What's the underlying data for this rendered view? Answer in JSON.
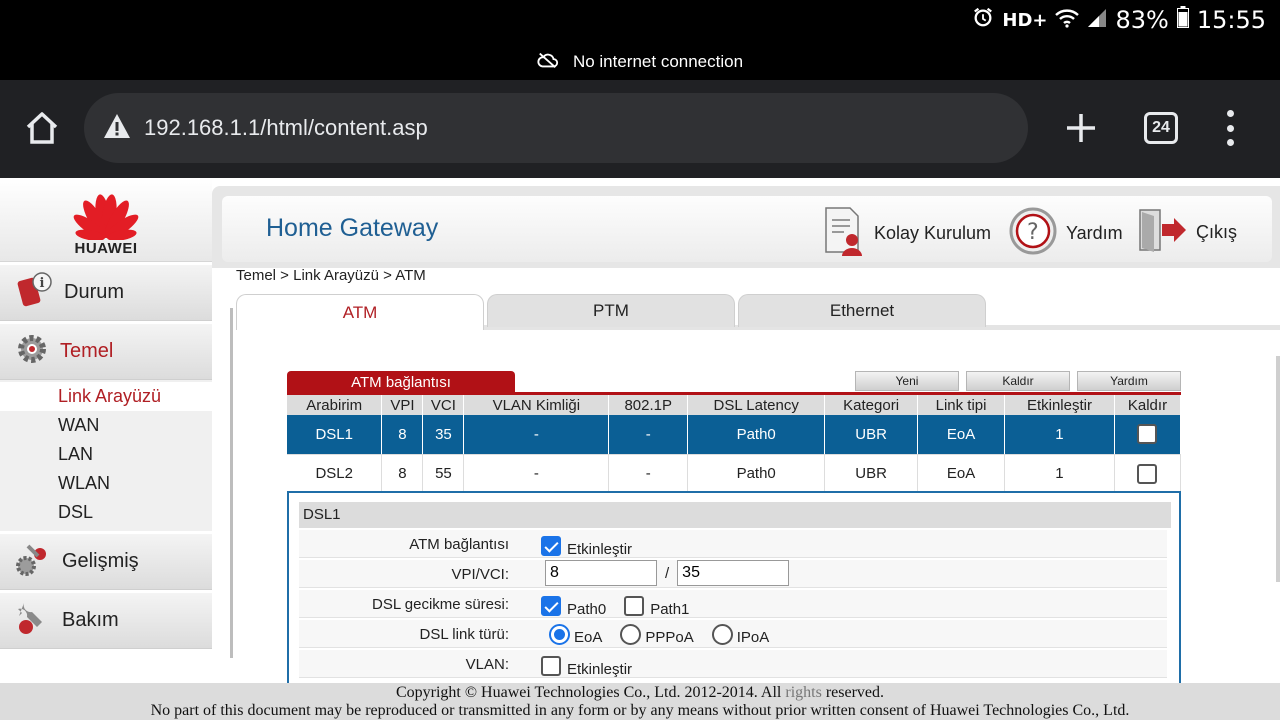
{
  "status_bar": {
    "alarm_icon": "alarm-icon",
    "network_type": "HD+",
    "battery_percent": "83%",
    "time": "15:55"
  },
  "connection_banner": {
    "text": "No internet connection"
  },
  "browser": {
    "url": "192.168.1.1/html/content.asp",
    "tab_count": "24"
  },
  "sidebar": {
    "logo_text": "HUAWEI",
    "items": [
      {
        "label": "Durum"
      },
      {
        "label": "Temel"
      },
      {
        "label": "Gelişmiş"
      },
      {
        "label": "Bakım"
      }
    ],
    "sub_items": [
      "Link Arayüzü",
      "WAN",
      "LAN",
      "WLAN",
      "DSL"
    ]
  },
  "header": {
    "title": "Home Gateway",
    "quick_setup": "Kolay Kurulum",
    "help": "Yardım",
    "exit": "Çıkış"
  },
  "breadcrumb": "Temel > Link Arayüzü > ATM",
  "tabs": [
    "ATM",
    "PTM",
    "Ethernet"
  ],
  "atm_table": {
    "title": "ATM bağlantısı",
    "buttons": {
      "new": "Yeni",
      "remove": "Kaldır",
      "help": "Yardım"
    },
    "columns": [
      "Arabirim",
      "VPI",
      "VCI",
      "VLAN Kimliği",
      "802.1P",
      "DSL Latency",
      "Kategori",
      "Link tipi",
      "Etkinleştir",
      "Kaldır"
    ],
    "rows": [
      {
        "cells": [
          "DSL1",
          "8",
          "35",
          "-",
          "-",
          "Path0",
          "UBR",
          "EoA",
          "1"
        ],
        "selected": true
      },
      {
        "cells": [
          "DSL2",
          "8",
          "55",
          "-",
          "-",
          "Path0",
          "UBR",
          "EoA",
          "1"
        ],
        "selected": false
      }
    ]
  },
  "detail": {
    "title": "DSL1",
    "atm_connection_label": "ATM bağlantısı",
    "atm_connection_value": "Etkinleştir",
    "vpi_vci_label": "VPI/VCI:",
    "vpi": "8",
    "separator": "/",
    "vci": "35",
    "latency_label": "DSL gecikme süresi:",
    "path0": "Path0",
    "path1": "Path1",
    "link_type_label": "DSL link türü:",
    "eoa": "EoA",
    "pppoa": "PPPoA",
    "ipoa": "IPoA",
    "vlan_label": "VLAN:",
    "vlan_value": "Etkinleştir"
  },
  "footer": {
    "line1_a": "Copyright © Huawei Technologies Co., Ltd. 2012-2014. All",
    "line1_b": "rights",
    "line1_c": "reserved.",
    "line2": "No part of this document may be reproduced or transmitted in any form or by any means without prior written consent of Huawei Technologies Co., Ltd."
  },
  "colors": {
    "brand_red": "#b11116",
    "selected_row": "#0b5f95",
    "title_blue": "#1f5f93",
    "checkbox_blue": "#1a73e8"
  }
}
